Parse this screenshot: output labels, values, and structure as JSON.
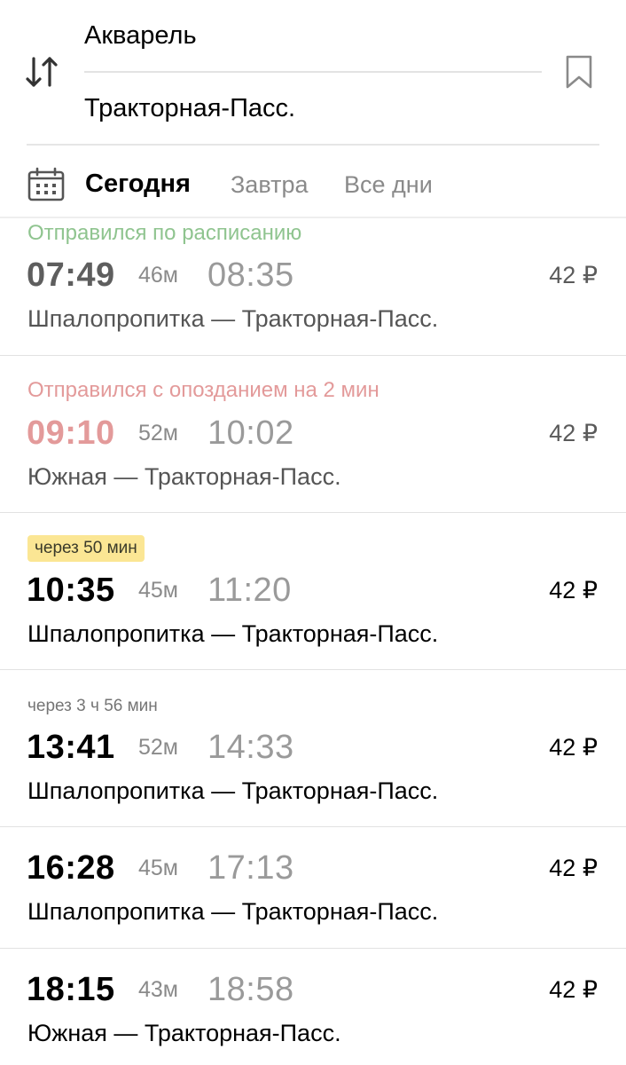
{
  "header": {
    "from": "Акварель",
    "to": "Тракторная-Пасс."
  },
  "tabs": {
    "today": "Сегодня",
    "tomorrow": "Завтра",
    "all_days": "Все дни"
  },
  "trips": [
    {
      "status": "Отправился по расписанию",
      "departure": "07:49",
      "duration": "46м",
      "arrival": "08:35",
      "price": "42 ₽",
      "route": "Шпалопропитка — Тракторная-Пасс."
    },
    {
      "status": "Отправился с опозданием на 2 мин",
      "departure": "09:10",
      "duration": "52м",
      "arrival": "10:02",
      "price": "42 ₽",
      "route": "Южная — Тракторная-Пасс."
    },
    {
      "status": "через 50 мин",
      "departure": "10:35",
      "duration": "45м",
      "arrival": "11:20",
      "price": "42 ₽",
      "route": "Шпалопропитка — Тракторная-Пасс."
    },
    {
      "status": "через 3 ч 56 мин",
      "departure": "13:41",
      "duration": "52м",
      "arrival": "14:33",
      "price": "42 ₽",
      "route": "Шпалопропитка — Тракторная-Пасс."
    },
    {
      "departure": "16:28",
      "duration": "45м",
      "arrival": "17:13",
      "price": "42 ₽",
      "route": "Шпалопропитка — Тракторная-Пасс."
    },
    {
      "departure": "18:15",
      "duration": "43м",
      "arrival": "18:58",
      "price": "42 ₽",
      "route": "Южная — Тракторная-Пасс."
    }
  ],
  "colors": {
    "status_on_time": "#8fc48f",
    "status_late": "#e39a9a",
    "badge_background": "#fbe694",
    "muted_text": "#8a8a8a"
  }
}
